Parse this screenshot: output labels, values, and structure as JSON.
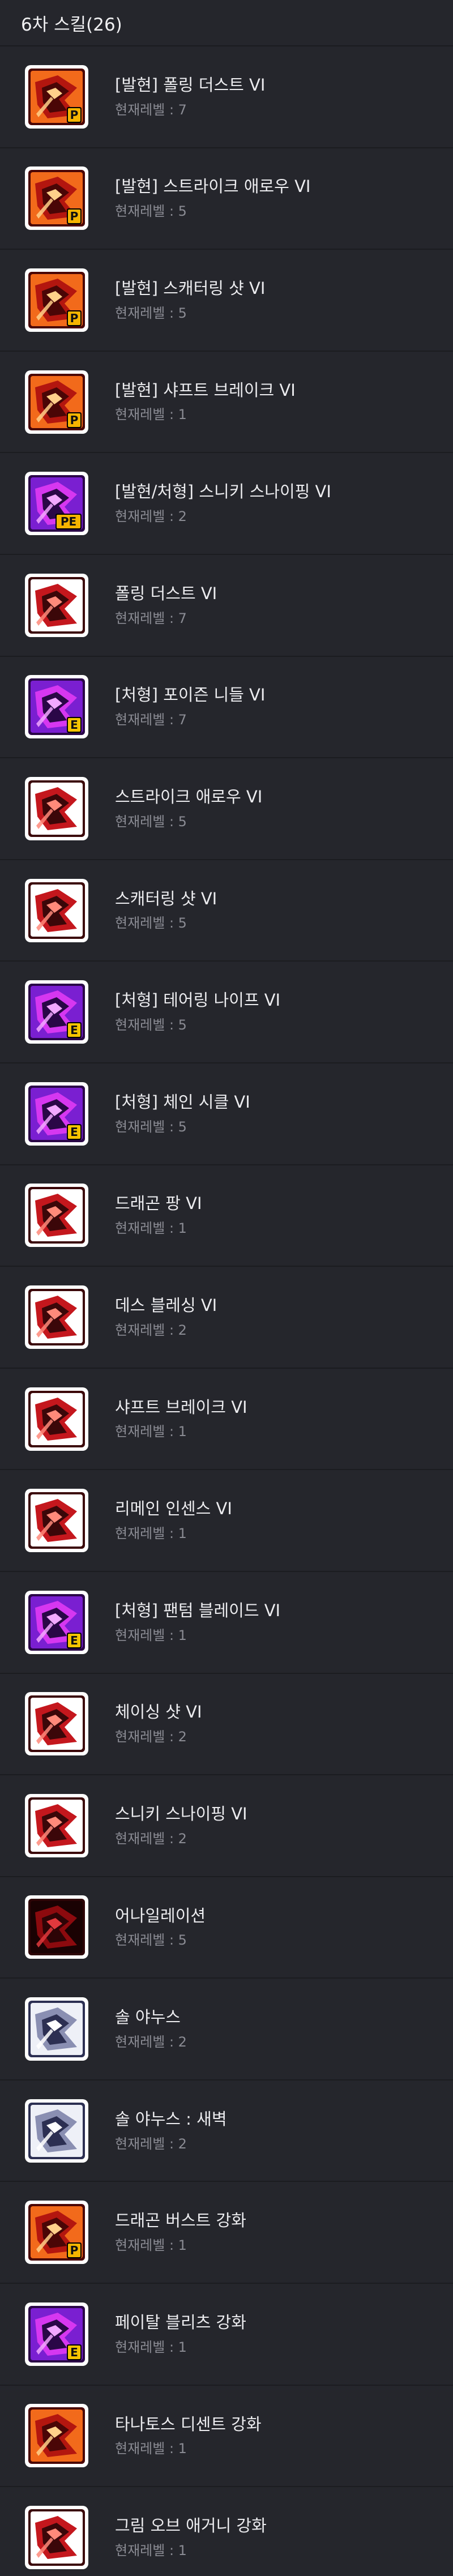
{
  "header": {
    "title": "6차 스킬(26)"
  },
  "skills": [
    {
      "name": "[발현] 폴링 더스트 VI",
      "level": "현재레벨 : 7",
      "icon": "falling-dust-origin-icon",
      "theme": "orange",
      "badge": "P"
    },
    {
      "name": "[발현] 스트라이크 애로우 VI",
      "level": "현재레벨 : 5",
      "icon": "strike-arrow-origin-icon",
      "theme": "orange",
      "badge": "P"
    },
    {
      "name": "[발현] 스캐터링 샷 VI",
      "level": "현재레벨 : 5",
      "icon": "scattering-shot-origin-icon",
      "theme": "orange",
      "badge": "P"
    },
    {
      "name": "[발현] 샤프트 브레이크 VI",
      "level": "현재레벨 : 1",
      "icon": "shaft-break-origin-icon",
      "theme": "orange",
      "badge": "P"
    },
    {
      "name": "[발현/처형] 스니키 스나이핑 VI",
      "level": "현재레벨 : 2",
      "icon": "sneaky-sniping-origin-icon",
      "theme": "purple",
      "badge": "PE"
    },
    {
      "name": "폴링 더스트 VI",
      "level": "현재레벨 : 7",
      "icon": "falling-dust-icon",
      "theme": "red",
      "badge": ""
    },
    {
      "name": "[처형] 포이즌 니들 VI",
      "level": "현재레벨 : 7",
      "icon": "poison-needle-icon",
      "theme": "purple",
      "badge": "E"
    },
    {
      "name": "스트라이크 애로우 VI",
      "level": "현재레벨 : 5",
      "icon": "strike-arrow-icon",
      "theme": "red",
      "badge": ""
    },
    {
      "name": "스캐터링 샷 VI",
      "level": "현재레벨 : 5",
      "icon": "scattering-shot-icon",
      "theme": "red",
      "badge": ""
    },
    {
      "name": "[처형] 테어링 나이프 VI",
      "level": "현재레벨 : 5",
      "icon": "tearing-knife-icon",
      "theme": "purple",
      "badge": "E"
    },
    {
      "name": "[처형] 체인 시클 VI",
      "level": "현재레벨 : 5",
      "icon": "chain-sickle-icon",
      "theme": "purple",
      "badge": "E"
    },
    {
      "name": "드래곤 팡 VI",
      "level": "현재레벨 : 1",
      "icon": "dragon-fang-icon",
      "theme": "red",
      "badge": ""
    },
    {
      "name": "데스 블레싱 VI",
      "level": "현재레벨 : 2",
      "icon": "death-blessing-icon",
      "theme": "red",
      "badge": ""
    },
    {
      "name": "샤프트 브레이크 VI",
      "level": "현재레벨 : 1",
      "icon": "shaft-break-icon",
      "theme": "red",
      "badge": ""
    },
    {
      "name": "리메인 인센스 VI",
      "level": "현재레벨 : 1",
      "icon": "remain-incense-icon",
      "theme": "red",
      "badge": ""
    },
    {
      "name": "[처형] 팬텀 블레이드 VI",
      "level": "현재레벨 : 1",
      "icon": "phantom-blade-icon",
      "theme": "purple",
      "badge": "E"
    },
    {
      "name": "체이싱 샷 VI",
      "level": "현재레벨 : 2",
      "icon": "chasing-shot-icon",
      "theme": "red",
      "badge": ""
    },
    {
      "name": "스니키 스나이핑 VI",
      "level": "현재레벨 : 2",
      "icon": "sneaky-sniping-icon",
      "theme": "red",
      "badge": ""
    },
    {
      "name": "어나일레이션",
      "level": "현재레벨 : 5",
      "icon": "annihilation-icon",
      "theme": "darkred",
      "badge": ""
    },
    {
      "name": "솔 야누스",
      "level": "현재레벨 : 2",
      "icon": "sol-janus-icon",
      "theme": "silver",
      "badge": ""
    },
    {
      "name": "솔 야누스 : 새벽",
      "level": "현재레벨 : 2",
      "icon": "sol-janus-dawn-icon",
      "theme": "silver",
      "badge": ""
    },
    {
      "name": "드래곤 버스트 강화",
      "level": "현재레벨 : 1",
      "icon": "dragon-burst-boost-icon",
      "theme": "orange",
      "badge": "P"
    },
    {
      "name": "페이탈 블리츠 강화",
      "level": "현재레벨 : 1",
      "icon": "fatal-blitz-boost-icon",
      "theme": "purple",
      "badge": "E"
    },
    {
      "name": "타나토스 디센트 강화",
      "level": "현재레벨 : 1",
      "icon": "thanatos-descent-boost-icon",
      "theme": "orange",
      "badge": ""
    },
    {
      "name": "그림 오브 애거니 강화",
      "level": "현재레벨 : 1",
      "icon": "grim-of-agony-boost-icon",
      "theme": "red",
      "badge": ""
    }
  ],
  "themes": {
    "orange": {
      "bg": "#f26a1b",
      "mid": "#b3160f",
      "dark": "#4a0606",
      "light": "#ffd08a"
    },
    "red": {
      "bg": "#ffffff",
      "mid": "#c4171d",
      "dark": "#3b0709",
      "light": "#ff8a7a"
    },
    "purple": {
      "bg": "#7a1fd1",
      "mid": "#d637f0",
      "dark": "#2a0747",
      "light": "#f2a8ff"
    },
    "darkred": {
      "bg": "#1a0203",
      "mid": "#8c0a0e",
      "dark": "#2d0406",
      "light": "#e2393d"
    },
    "silver": {
      "bg": "#eef0f7",
      "mid": "#8a8fb2",
      "dark": "#2c2f52",
      "light": "#ffffff"
    }
  },
  "badge_colors": {
    "P": "#f5b400",
    "E": "#f5c400",
    "PE": "#f5b400"
  }
}
